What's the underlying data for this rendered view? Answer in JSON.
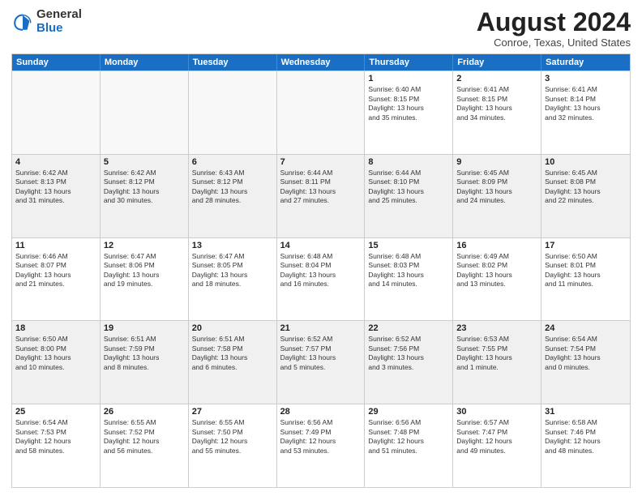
{
  "logo": {
    "general": "General",
    "blue": "Blue"
  },
  "header": {
    "month": "August 2024",
    "location": "Conroe, Texas, United States"
  },
  "days_of_week": [
    "Sunday",
    "Monday",
    "Tuesday",
    "Wednesday",
    "Thursday",
    "Friday",
    "Saturday"
  ],
  "rows": [
    {
      "alt": false,
      "cells": [
        {
          "day": "",
          "info": ""
        },
        {
          "day": "",
          "info": ""
        },
        {
          "day": "",
          "info": ""
        },
        {
          "day": "",
          "info": ""
        },
        {
          "day": "1",
          "info": "Sunrise: 6:40 AM\nSunset: 8:15 PM\nDaylight: 13 hours\nand 35 minutes."
        },
        {
          "day": "2",
          "info": "Sunrise: 6:41 AM\nSunset: 8:15 PM\nDaylight: 13 hours\nand 34 minutes."
        },
        {
          "day": "3",
          "info": "Sunrise: 6:41 AM\nSunset: 8:14 PM\nDaylight: 13 hours\nand 32 minutes."
        }
      ]
    },
    {
      "alt": true,
      "cells": [
        {
          "day": "4",
          "info": "Sunrise: 6:42 AM\nSunset: 8:13 PM\nDaylight: 13 hours\nand 31 minutes."
        },
        {
          "day": "5",
          "info": "Sunrise: 6:42 AM\nSunset: 8:12 PM\nDaylight: 13 hours\nand 30 minutes."
        },
        {
          "day": "6",
          "info": "Sunrise: 6:43 AM\nSunset: 8:12 PM\nDaylight: 13 hours\nand 28 minutes."
        },
        {
          "day": "7",
          "info": "Sunrise: 6:44 AM\nSunset: 8:11 PM\nDaylight: 13 hours\nand 27 minutes."
        },
        {
          "day": "8",
          "info": "Sunrise: 6:44 AM\nSunset: 8:10 PM\nDaylight: 13 hours\nand 25 minutes."
        },
        {
          "day": "9",
          "info": "Sunrise: 6:45 AM\nSunset: 8:09 PM\nDaylight: 13 hours\nand 24 minutes."
        },
        {
          "day": "10",
          "info": "Sunrise: 6:45 AM\nSunset: 8:08 PM\nDaylight: 13 hours\nand 22 minutes."
        }
      ]
    },
    {
      "alt": false,
      "cells": [
        {
          "day": "11",
          "info": "Sunrise: 6:46 AM\nSunset: 8:07 PM\nDaylight: 13 hours\nand 21 minutes."
        },
        {
          "day": "12",
          "info": "Sunrise: 6:47 AM\nSunset: 8:06 PM\nDaylight: 13 hours\nand 19 minutes."
        },
        {
          "day": "13",
          "info": "Sunrise: 6:47 AM\nSunset: 8:05 PM\nDaylight: 13 hours\nand 18 minutes."
        },
        {
          "day": "14",
          "info": "Sunrise: 6:48 AM\nSunset: 8:04 PM\nDaylight: 13 hours\nand 16 minutes."
        },
        {
          "day": "15",
          "info": "Sunrise: 6:48 AM\nSunset: 8:03 PM\nDaylight: 13 hours\nand 14 minutes."
        },
        {
          "day": "16",
          "info": "Sunrise: 6:49 AM\nSunset: 8:02 PM\nDaylight: 13 hours\nand 13 minutes."
        },
        {
          "day": "17",
          "info": "Sunrise: 6:50 AM\nSunset: 8:01 PM\nDaylight: 13 hours\nand 11 minutes."
        }
      ]
    },
    {
      "alt": true,
      "cells": [
        {
          "day": "18",
          "info": "Sunrise: 6:50 AM\nSunset: 8:00 PM\nDaylight: 13 hours\nand 10 minutes."
        },
        {
          "day": "19",
          "info": "Sunrise: 6:51 AM\nSunset: 7:59 PM\nDaylight: 13 hours\nand 8 minutes."
        },
        {
          "day": "20",
          "info": "Sunrise: 6:51 AM\nSunset: 7:58 PM\nDaylight: 13 hours\nand 6 minutes."
        },
        {
          "day": "21",
          "info": "Sunrise: 6:52 AM\nSunset: 7:57 PM\nDaylight: 13 hours\nand 5 minutes."
        },
        {
          "day": "22",
          "info": "Sunrise: 6:52 AM\nSunset: 7:56 PM\nDaylight: 13 hours\nand 3 minutes."
        },
        {
          "day": "23",
          "info": "Sunrise: 6:53 AM\nSunset: 7:55 PM\nDaylight: 13 hours\nand 1 minute."
        },
        {
          "day": "24",
          "info": "Sunrise: 6:54 AM\nSunset: 7:54 PM\nDaylight: 13 hours\nand 0 minutes."
        }
      ]
    },
    {
      "alt": false,
      "cells": [
        {
          "day": "25",
          "info": "Sunrise: 6:54 AM\nSunset: 7:53 PM\nDaylight: 12 hours\nand 58 minutes."
        },
        {
          "day": "26",
          "info": "Sunrise: 6:55 AM\nSunset: 7:52 PM\nDaylight: 12 hours\nand 56 minutes."
        },
        {
          "day": "27",
          "info": "Sunrise: 6:55 AM\nSunset: 7:50 PM\nDaylight: 12 hours\nand 55 minutes."
        },
        {
          "day": "28",
          "info": "Sunrise: 6:56 AM\nSunset: 7:49 PM\nDaylight: 12 hours\nand 53 minutes."
        },
        {
          "day": "29",
          "info": "Sunrise: 6:56 AM\nSunset: 7:48 PM\nDaylight: 12 hours\nand 51 minutes."
        },
        {
          "day": "30",
          "info": "Sunrise: 6:57 AM\nSunset: 7:47 PM\nDaylight: 12 hours\nand 49 minutes."
        },
        {
          "day": "31",
          "info": "Sunrise: 6:58 AM\nSunset: 7:46 PM\nDaylight: 12 hours\nand 48 minutes."
        }
      ]
    }
  ]
}
